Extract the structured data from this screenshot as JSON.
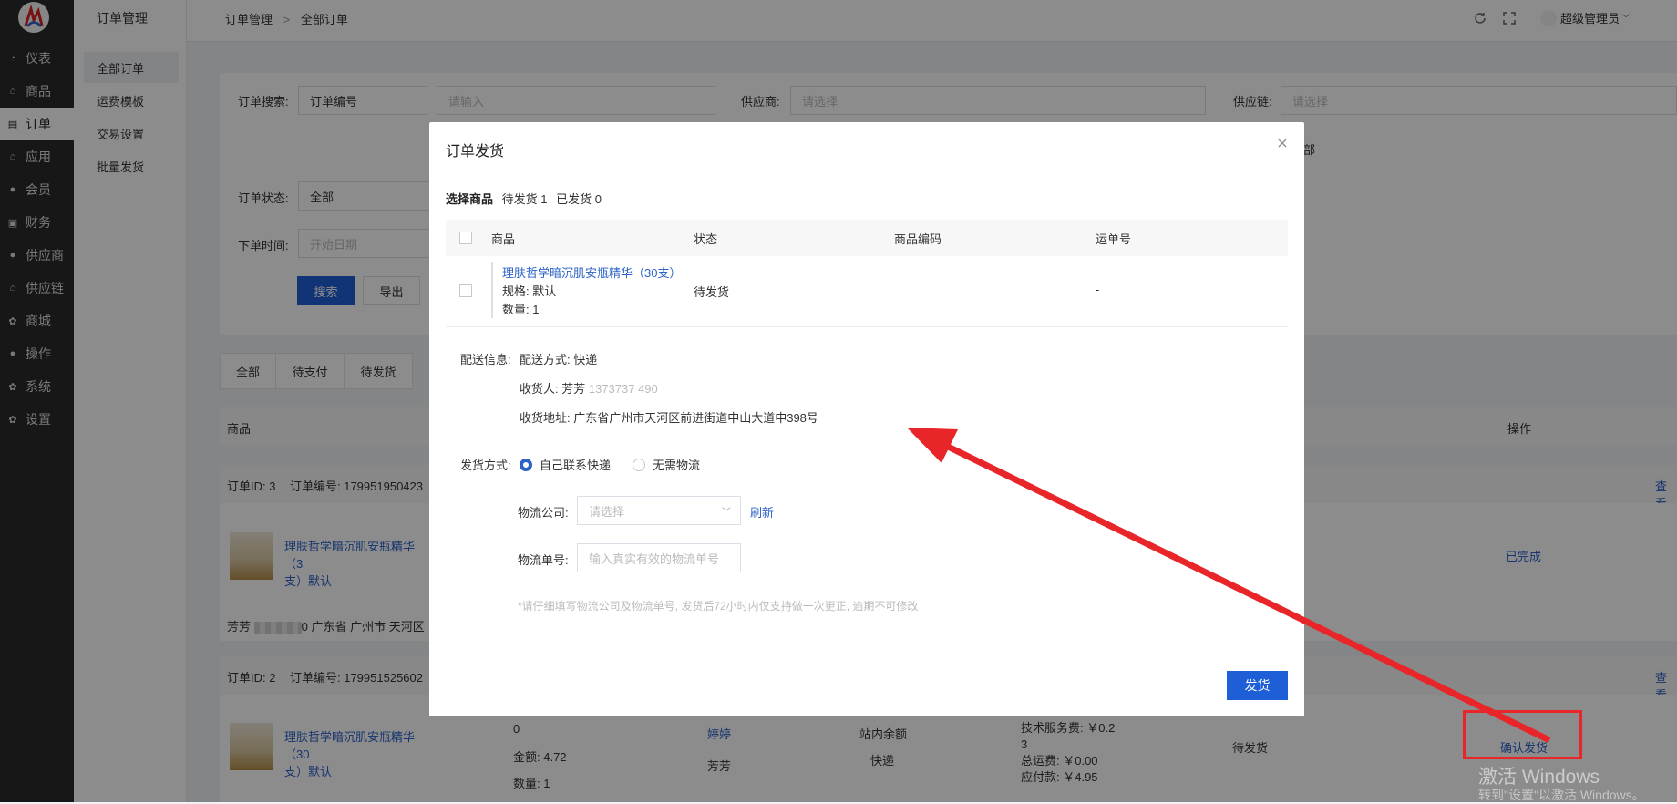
{
  "sidebar": {
    "items": [
      {
        "label": "仪表",
        "icon": "dashboard-icon"
      },
      {
        "label": "商品",
        "icon": "home-icon"
      },
      {
        "label": "订单",
        "icon": "order-icon"
      },
      {
        "label": "应用",
        "icon": "home-icon"
      },
      {
        "label": "会员",
        "icon": "user-icon"
      },
      {
        "label": "财务",
        "icon": "wallet-icon"
      },
      {
        "label": "供应商",
        "icon": "user-icon"
      },
      {
        "label": "供应链",
        "icon": "home-icon"
      },
      {
        "label": "商城",
        "icon": "gear-icon"
      },
      {
        "label": "操作",
        "icon": "user-icon"
      },
      {
        "label": "系统",
        "icon": "gear-icon"
      },
      {
        "label": "设置",
        "icon": "gear-icon"
      }
    ],
    "active_index": 2
  },
  "subnav": {
    "title": "订单管理",
    "items": [
      "全部订单",
      "运费模板",
      "交易设置",
      "批量发货"
    ]
  },
  "topbar": {
    "crumb_root": "订单管理",
    "crumb_sep": ">",
    "crumb_current": "全部订单",
    "user": "超级管理员"
  },
  "filters": {
    "search_label": "订单搜索:",
    "search_type": "订单编号",
    "search_placeholder": "请输入",
    "supplier_label": "供应商:",
    "supplier_placeholder": "请选择",
    "chain_label": "供应链:",
    "chain_placeholder": "请选择",
    "partial_text": "部",
    "status_label": "订单状态:",
    "status_value": "全部",
    "time_label": "下单时间:",
    "time_placeholder": "开始日期",
    "search_btn": "搜索",
    "export_btn": "导出"
  },
  "tabs": [
    "全部",
    "待支付",
    "待发货"
  ],
  "table": {
    "col_goods": "商品",
    "col_action": "操作"
  },
  "orders": [
    {
      "id_text": "订单ID: 3",
      "no_text": "订单编号: 179951950423",
      "product": "理肤哲学暗沉肌安瓶精华（30支）默认",
      "product_l1": "理肤哲学暗沉肌安瓶精华（3",
      "product_l2": "支）默认",
      "status": "已完成",
      "view": "查看",
      "address_prefix": "芳芳",
      "address_suffix": "0 广东省 广州市 天河区"
    },
    {
      "id_text": "订单ID: 2",
      "no_text": "订单编号: 179951525602",
      "product_l1": "理肤哲学暗沉肌安瓶精华（30",
      "product_l2": "支）默认",
      "price": "0",
      "amount": "金额: 4.72",
      "qty": "数量: 1",
      "buyer1": "婷婷",
      "buyer2": "芳芳",
      "pay": "站内余额",
      "ship": "快递",
      "fee1": "技术服务费: ￥0.2",
      "fee2": "3",
      "fee3": "总运费: ￥0.00",
      "fee4": "应付款: ￥4.95",
      "status": "待发货",
      "action": "确认发货",
      "view": "查看"
    }
  ],
  "modal": {
    "title": "订单发货",
    "select_label": "选择商品",
    "pending": "待发货 1",
    "shipped": "已发货 0",
    "headers": [
      "商品",
      "状态",
      "商品编码",
      "运单号"
    ],
    "row": {
      "name": "理肤哲学暗沉肌安瓶精华（30支）",
      "spec": "规格: 默认",
      "qty": "数量: 1",
      "status": "待发货",
      "code": "",
      "waybill": "-"
    },
    "delivery_label": "配送信息:",
    "delivery_method": "配送方式: 快递",
    "receiver_prefix": "收货人: 芳芳 ",
    "receiver_phone": "1373737 490",
    "address": "收货地址: 广东省广州市天河区前进街道中山大道中398号",
    "ship_mode_label": "发货方式:",
    "opt_self": "自己联系快递",
    "opt_none": "无需物流",
    "company_label": "物流公司:",
    "company_placeholder": "请选择",
    "refresh": "刷新",
    "tracking_label": "物流单号:",
    "tracking_placeholder": "输入真实有效的物流单号",
    "hint": "*请仔细填写物流公司及物流单号, 发货后72小时内仅支持做一次更正, 逾期不可修改",
    "submit": "发货"
  },
  "watermark": {
    "line1": "激活 Windows",
    "line2": "转到\"设置\"以激活 Windows。"
  },
  "colors": {
    "primary": "#1e5fd8",
    "annotation": "#e8262a",
    "sidebar": "#2b2b2b"
  }
}
